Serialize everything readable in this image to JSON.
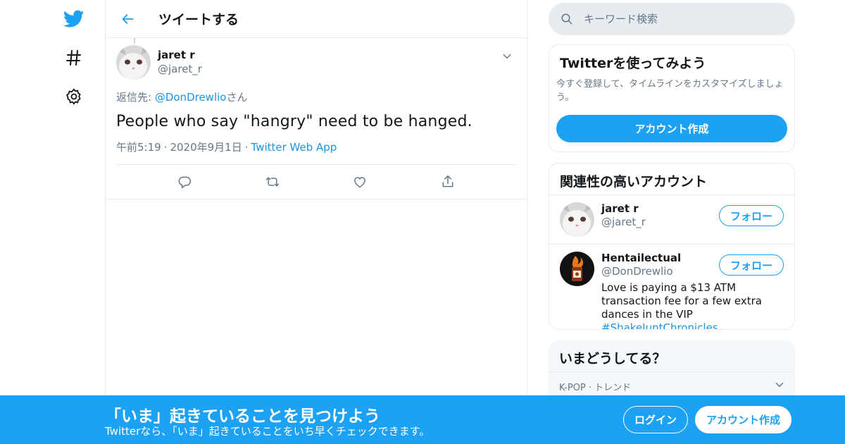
{
  "colors": {
    "brand": "#1da1f2",
    "link": "#1b95e0",
    "muted": "#657786",
    "border": "#e6ecf0"
  },
  "nav": {
    "logo_icon": "twitter-bird-icon",
    "explore_icon": "hashtag-icon",
    "settings_icon": "gear-icon"
  },
  "header": {
    "title": "ツイートする",
    "back_icon": "arrow-left-icon"
  },
  "tweet": {
    "author_name": "jaret r",
    "author_handle": "@jaret_r",
    "reply_prefix": "返信先: ",
    "reply_mention": "@DonDrewlio",
    "reply_suffix": "さん",
    "text": "People who say \"hangry\" need to be hanged.",
    "time": "午前5:19",
    "date": "2020年9月1日",
    "source": "Twitter Web App",
    "dot": "·",
    "actions": [
      "reply-icon",
      "retweet-icon",
      "like-icon",
      "share-icon"
    ]
  },
  "search": {
    "placeholder": "キーワード検索"
  },
  "signup_card": {
    "title": "Twitterを使ってみよう",
    "description": "今すぐ登録して、タイムラインをカスタマイズしましょう。",
    "button": "アカウント作成"
  },
  "related": {
    "title": "関連性の高いアカウント",
    "accounts": [
      {
        "name": "jaret r",
        "handle": "@jaret_r",
        "follow": "フォロー",
        "bio": "",
        "hashtag": ""
      },
      {
        "name": "Hentailectual",
        "handle": "@DonDrewlio",
        "follow": "フォロー",
        "bio": "Love is paying a $13 ATM transaction fee for a few extra dances in the VIP ",
        "hashtag": "#ShakeJuntChronicles"
      }
    ]
  },
  "trends": {
    "title": "いまどうしてる？",
    "first_meta": "K-POP · トレンド"
  },
  "bottom_bar": {
    "title": "「いま」起きていることを見つけよう",
    "subtitle": "Twitterなら、「いま」起きていることをいち早くチェックできます。",
    "login": "ログイン",
    "signup": "アカウント作成"
  }
}
